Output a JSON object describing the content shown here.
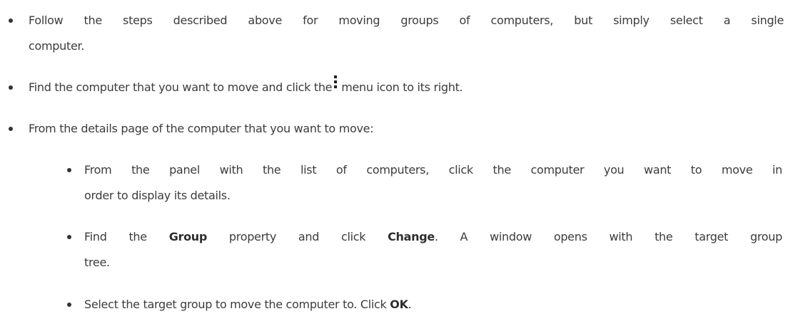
{
  "list": {
    "items": [
      {
        "line1": "Follow the steps described above for moving groups of computers, but simply select a single",
        "line2": "computer."
      },
      {
        "before_icon": "Find the computer that you want to move and click the",
        "icon": "vertical-ellipsis-menu-icon",
        "after_icon": "menu icon to its right."
      },
      {
        "text": "From the details page of the computer that you want to move:",
        "subitems": [
          {
            "line1": "From the panel with the list of computers, click the computer you want to move in",
            "line2": "order to display its details."
          },
          {
            "pre": "Find the ",
            "bold1": "Group",
            "mid": " property and click ",
            "bold2": "Change",
            "post": ". A window opens with the target group",
            "line2": "tree."
          },
          {
            "pre": "Select the target group to move the computer to. Click ",
            "bold": "OK",
            "post": "."
          }
        ]
      }
    ]
  }
}
